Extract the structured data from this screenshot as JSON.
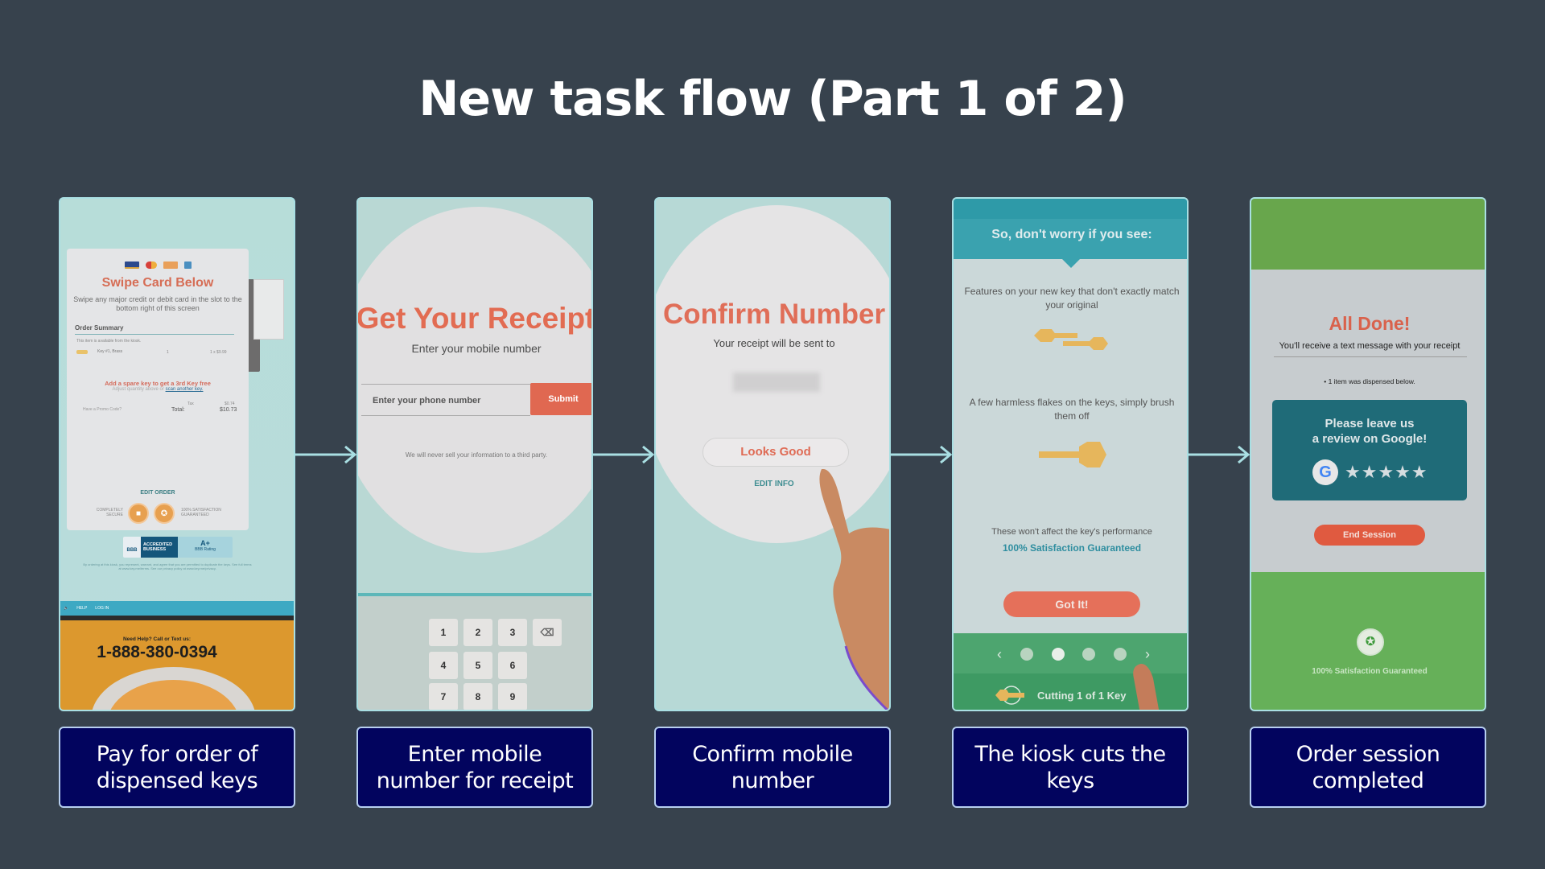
{
  "title": "New task flow (Part 1 of 2)",
  "steps": [
    {
      "caption": "Pay for order of dispensed keys",
      "screen": {
        "card_brands": [
          "VISA",
          "Mastercard",
          "Discover",
          "Amex"
        ],
        "heading": "Swipe Card Below",
        "subtext": "Swipe any major credit or debit card in the slot to the bottom right of this screen",
        "order_summary_label": "Order Summary",
        "availability_note": "This item is available from the kiosk.",
        "item_name": "Key #1, Brass",
        "item_qty": "1",
        "item_price": "1 x $9.99",
        "promo_headline": "Add a spare key to get a 3rd Key free",
        "promo_sub": "Adjust quantity above or",
        "promo_link": "scan another key.",
        "promo_code_label": "Have a Promo Code?",
        "tax_label": "Tax",
        "tax_value": "$0.74",
        "total_label": "Total:",
        "total_value": "$10.73",
        "edit_order": "EDIT ORDER",
        "secure_label": "COMPLETELY SECURE",
        "guarantee_label": "100% SATISFACTION GUARANTEED",
        "bbb_accredited": "ACCREDITED BUSINESS",
        "bbb_rating": "A+",
        "bbb_rating_label": "BBB Rating",
        "legal": "By ordering at this kiosk, you represent, warrant, and agree that you are permitted to duplicate the keys. See full terms at www.key.me/terms. See our privacy policy at www.key.me/privacy.",
        "nav_help": "HELP",
        "nav_login": "LOG IN",
        "help_line": "Need Help? Call or Text us:",
        "help_phone": "1-888-380-0394"
      }
    },
    {
      "caption": "Enter mobile number for receipt",
      "screen": {
        "heading": "Get Your Receipt",
        "subtext": "Enter your mobile number",
        "phone_placeholder": "Enter your phone number",
        "submit": "Submit",
        "privacy": "We will never sell your information to a third party.",
        "keypad": [
          "1",
          "2",
          "3",
          "4",
          "5",
          "6",
          "7",
          "8",
          "9"
        ]
      }
    },
    {
      "caption": "Confirm mobile number",
      "screen": {
        "heading": "Confirm Number",
        "subtext": "Your receipt will be sent to",
        "looks_good": "Looks Good",
        "edit_info": "EDIT INFO"
      }
    },
    {
      "caption": "The kiosk cuts the keys",
      "screen": {
        "heading": "So, don't worry if you see:",
        "point1": "Features on your new key that don't exactly match your original",
        "point2": "A few harmless flakes on the keys, simply brush them off",
        "point3": "These won't affect the key's performance",
        "guarantee": "100% Satisfaction Guaranteed",
        "got_it": "Got It!",
        "pager_total": 4,
        "pager_active": 2,
        "status": "Cutting 1 of 1 Key"
      }
    },
    {
      "caption": "Order session completed",
      "screen": {
        "heading": "All Done!",
        "subtext": "You'll receive a text message with your receipt",
        "dispensed": "1 item was dispensed below.",
        "review_line1": "Please leave us",
        "review_line2": "a review on Google!",
        "google_letter": "G",
        "stars": "★★★★★",
        "end_session": "End Session",
        "guarantee": "100% Satisfaction Guaranteed"
      }
    }
  ],
  "colors": {
    "background": "#37424d",
    "caption_bg": "#02045e",
    "arrow": "#a9dfe3",
    "accent_orange": "#e06851",
    "teal": "#3aa2af",
    "green": "#66b059"
  }
}
